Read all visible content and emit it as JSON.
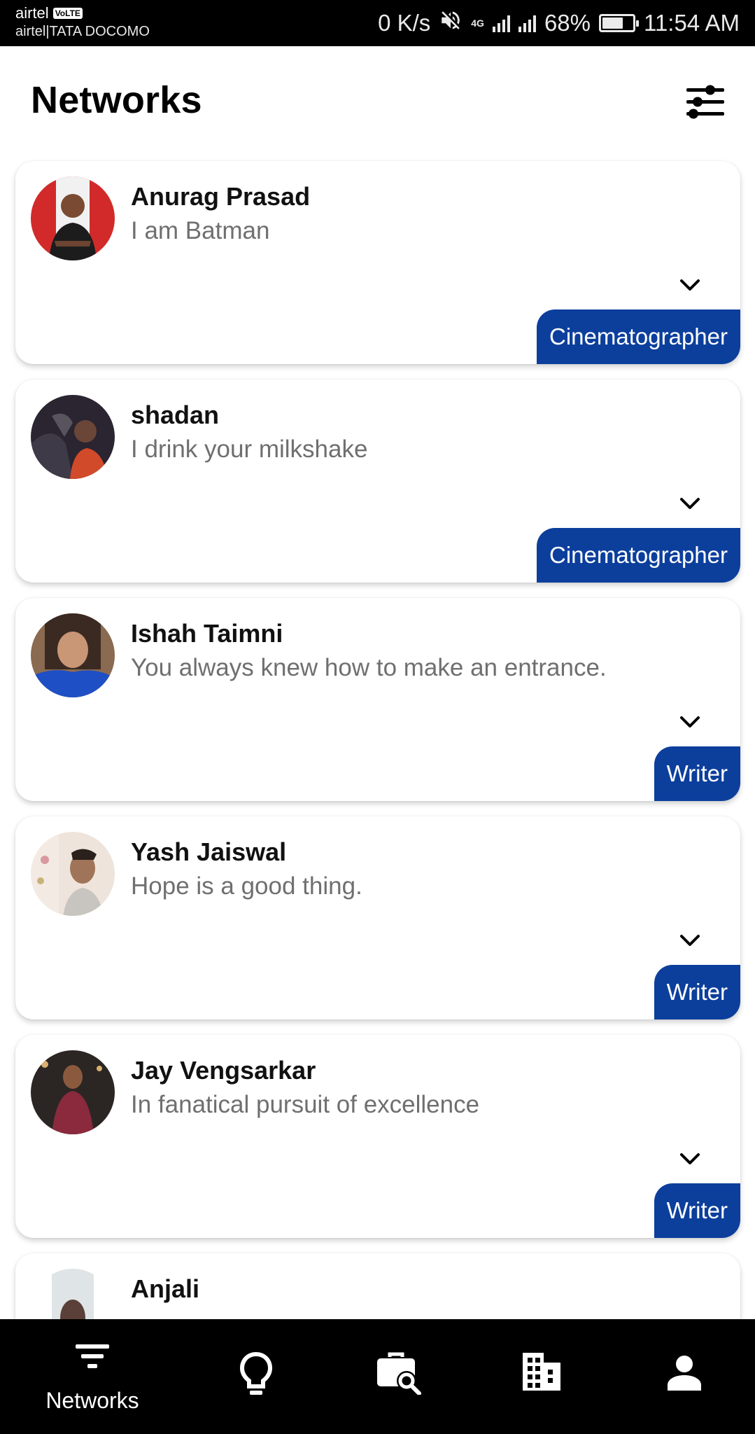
{
  "status_bar": {
    "carrier_primary": "airtel",
    "volte_badge": "VoLTE",
    "carrier_secondary": "airtel|TATA DOCOMO",
    "network_speed": "0 K/s",
    "network_type": "4G",
    "battery_percent": "68%",
    "battery_level": 0.68,
    "time": "11:54 AM",
    "icons": [
      "mute-icon",
      "signal-icon",
      "battery-icon"
    ]
  },
  "header": {
    "title": "Networks",
    "filter_icon": "sliders-icon"
  },
  "profiles": [
    {
      "name": "Anurag Prasad",
      "bio": "I am Batman",
      "role": "Cinematographer"
    },
    {
      "name": "shadan",
      "bio": "I drink your milkshake",
      "role": "Cinematographer"
    },
    {
      "name": "Ishah Taimni",
      "bio": "You always knew how to make an entrance.",
      "role": "Writer"
    },
    {
      "name": "Yash Jaiswal",
      "bio": "Hope is a good thing.",
      "role": "Writer"
    },
    {
      "name": "Jay Vengsarkar",
      "bio": "In fanatical pursuit of excellence",
      "role": "Writer"
    },
    {
      "name": "Anjali",
      "bio": "",
      "role": ""
    }
  ],
  "bottom_nav": {
    "active": "networks",
    "items": [
      {
        "id": "networks",
        "label": "Networks",
        "icon": "filter-lines-icon"
      },
      {
        "id": "ideas",
        "label": "",
        "icon": "lightbulb-icon"
      },
      {
        "id": "jobs",
        "label": "",
        "icon": "briefcase-search-icon"
      },
      {
        "id": "companies",
        "label": "",
        "icon": "building-icon"
      },
      {
        "id": "profile",
        "label": "",
        "icon": "person-icon"
      }
    ]
  },
  "colors": {
    "role_badge": "#0c3f9c",
    "status_bar_bg": "#000000",
    "nav_bg": "#000000",
    "bio_text": "#6f6f6f"
  }
}
